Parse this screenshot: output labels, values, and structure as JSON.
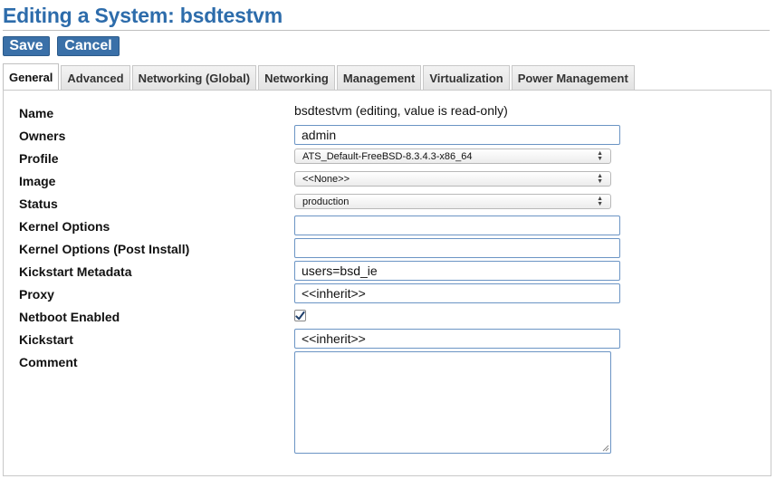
{
  "page": {
    "title": "Editing a System: bsdtestvm"
  },
  "toolbar": {
    "save_label": "Save",
    "cancel_label": "Cancel"
  },
  "tabs": [
    {
      "label": "General",
      "active": true
    },
    {
      "label": "Advanced",
      "active": false
    },
    {
      "label": "Networking (Global)",
      "active": false
    },
    {
      "label": "Networking",
      "active": false
    },
    {
      "label": "Management",
      "active": false
    },
    {
      "label": "Virtualization",
      "active": false
    },
    {
      "label": "Power Management",
      "active": false
    }
  ],
  "form": {
    "name": {
      "label": "Name",
      "value": "bsdtestvm (editing, value is read-only)"
    },
    "owners": {
      "label": "Owners",
      "value": "admin"
    },
    "profile": {
      "label": "Profile",
      "value": "ATS_Default-FreeBSD-8.3.4.3-x86_64"
    },
    "image": {
      "label": "Image",
      "value": "<<None>>"
    },
    "status": {
      "label": "Status",
      "value": "production"
    },
    "kernel_options": {
      "label": "Kernel Options",
      "value": ""
    },
    "kernel_options_post": {
      "label": "Kernel Options (Post Install)",
      "value": ""
    },
    "kickstart_metadata": {
      "label": "Kickstart Metadata",
      "value": "users=bsd_ie"
    },
    "proxy": {
      "label": "Proxy",
      "value": "<<inherit>>"
    },
    "netboot_enabled": {
      "label": "Netboot Enabled",
      "checked": true
    },
    "kickstart": {
      "label": "Kickstart",
      "value": "<<inherit>>"
    },
    "comment": {
      "label": "Comment",
      "value": ""
    }
  },
  "colors": {
    "title": "#2d6cab",
    "button": "#3a70a8",
    "field_border": "#6b94c4"
  }
}
